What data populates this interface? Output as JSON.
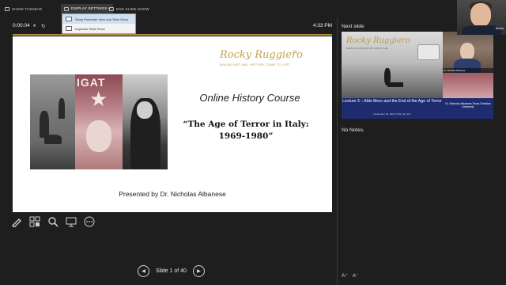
{
  "toolbar": {
    "items": [
      "SHOW TASKBAR",
      "DISPLAY SETTINGS ▾",
      "END SLIDE SHOW"
    ],
    "dropdown": [
      "Swap Presenter View and Slide Show",
      "Duplicate Slide Show"
    ]
  },
  "timer": {
    "elapsed": "0:00:04",
    "pause": "⏸",
    "reset": "↻",
    "clock": "4:33 PM"
  },
  "slide": {
    "logo": "Rocky Ruggiero",
    "logo_mark": "TM",
    "tagline": "MAKING ART AND HISTORY COME TO LIFE",
    "photo_text": "IGAT",
    "course": "Online History Course",
    "title": "“The Age of Terror in Italy: 1969-1980”",
    "presenter": "Presented by Dr. Nicholas Albanese"
  },
  "nav": {
    "label": "Slide 1 of 40",
    "prev": "◀",
    "next": "▶"
  },
  "next_slide": {
    "label": "Next slide",
    "logo": "Rocky Ruggiero",
    "tagline": "MAKING ART AND HISTORY COME TO LIFE",
    "speaker_name": "Dr. Nicholas Albanese",
    "lecture": "Lecture 3 – Aldo Moro and the End of the Age of Terror",
    "date": "September 20, 2022 (5:30-7pm ET)",
    "presenter": "Dr. Nicholas Albanese Texas Christian University"
  },
  "notes": {
    "text": "No Notes."
  },
  "font_controls": {
    "increase": "A⁺",
    "decrease": "A⁻"
  },
  "webcam": {
    "name": "Mario"
  }
}
